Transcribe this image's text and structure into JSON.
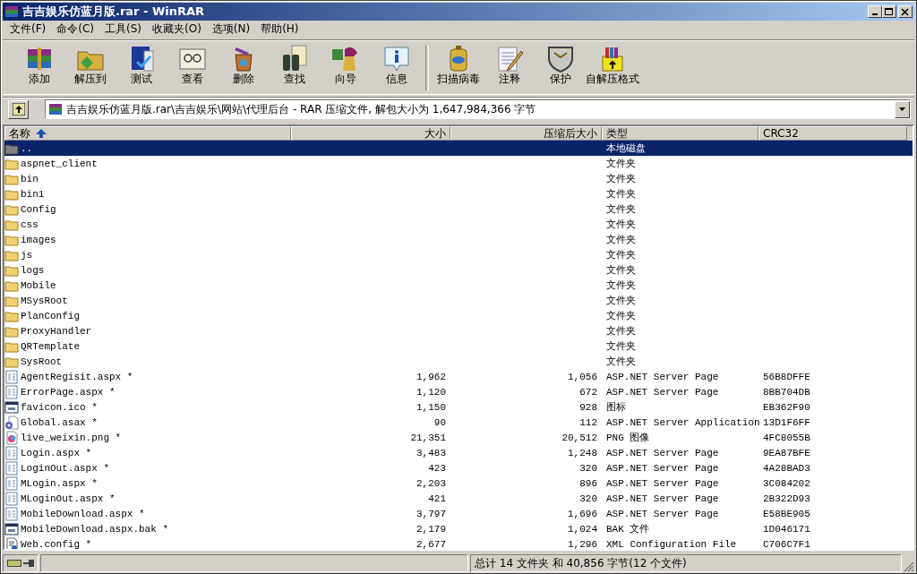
{
  "window": {
    "title": "吉吉娱乐仿蓝月版.rar - WinRAR"
  },
  "menu": [
    "文件(F)",
    "命令(C)",
    "工具(S)",
    "收藏夹(O)",
    "选项(N)",
    "帮助(H)"
  ],
  "toolbar_groups": [
    {
      "buttons": [
        "添加",
        "解压到",
        "测试",
        "查看",
        "删除",
        "查找",
        "向导",
        "信息"
      ]
    },
    {
      "buttons": [
        "扫描病毒",
        "注释",
        "保护",
        "自解压格式"
      ]
    }
  ],
  "address": {
    "value": "吉吉娱乐仿蓝月版.rar\\吉吉娱乐\\网站\\代理后台 - RAR 压缩文件, 解包大小为 1,647,984,366 字节"
  },
  "table": {
    "columns": [
      {
        "label": "名称",
        "sorted": true
      },
      {
        "label": "大小",
        "sorted": false
      },
      {
        "label": "压缩后大小",
        "sorted": false
      },
      {
        "label": "类型",
        "sorted": false
      },
      {
        "label": "CRC32",
        "sorted": false
      }
    ],
    "rows": [
      {
        "kind": "up",
        "name": "..",
        "type": "本地磁盘",
        "selected": true
      },
      {
        "kind": "folder",
        "name": "aspnet_client",
        "type": "文件夹",
        "selected": false
      },
      {
        "kind": "folder",
        "name": "bin",
        "type": "文件夹",
        "selected": false
      },
      {
        "kind": "folder",
        "name": "bin1",
        "type": "文件夹",
        "selected": false
      },
      {
        "kind": "folder",
        "name": "Config",
        "type": "文件夹",
        "selected": false
      },
      {
        "kind": "folder",
        "name": "css",
        "type": "文件夹",
        "selected": false
      },
      {
        "kind": "folder",
        "name": "images",
        "type": "文件夹",
        "selected": false
      },
      {
        "kind": "folder",
        "name": "js",
        "type": "文件夹",
        "selected": false
      },
      {
        "kind": "folder",
        "name": "logs",
        "type": "文件夹",
        "selected": false
      },
      {
        "kind": "folder",
        "name": "Mobile",
        "type": "文件夹",
        "selected": false
      },
      {
        "kind": "folder",
        "name": "MSysRoot",
        "type": "文件夹",
        "selected": false
      },
      {
        "kind": "folder",
        "name": "PlanConfig",
        "type": "文件夹",
        "selected": false
      },
      {
        "kind": "folder",
        "name": "ProxyHandler",
        "type": "文件夹",
        "selected": false
      },
      {
        "kind": "folder",
        "name": "QRTemplate",
        "type": "文件夹",
        "selected": false
      },
      {
        "kind": "folder",
        "name": "SysRoot",
        "type": "文件夹",
        "selected": false
      },
      {
        "kind": "page",
        "name": "AgentRegisit.aspx *",
        "size": "1,962",
        "packed": "1,056",
        "type": "ASP.NET Server Page",
        "crc": "56B8DFFE",
        "selected": false
      },
      {
        "kind": "page",
        "name": "ErrorPage.aspx *",
        "size": "1,120",
        "packed": "672",
        "type": "ASP.NET Server Page",
        "crc": "8BB704DB",
        "selected": false
      },
      {
        "kind": "window",
        "name": "favicon.ico *",
        "size": "1,150",
        "packed": "928",
        "type": "图标",
        "crc": "EB362F90",
        "selected": false
      },
      {
        "kind": "gear",
        "name": "Global.asax *",
        "size": "90",
        "packed": "112",
        "type": "ASP.NET Server Application",
        "crc": "13D1F6FF",
        "selected": false
      },
      {
        "kind": "picture",
        "name": "live_weixin.png *",
        "size": "21,351",
        "packed": "20,512",
        "type": "PNG 图像",
        "crc": "4FC8055B",
        "selected": false
      },
      {
        "kind": "page",
        "name": "Login.aspx *",
        "size": "3,483",
        "packed": "1,248",
        "type": "ASP.NET Server Page",
        "crc": "9EA87BFE",
        "selected": false
      },
      {
        "kind": "page",
        "name": "LoginOut.aspx *",
        "size": "423",
        "packed": "320",
        "type": "ASP.NET Server Page",
        "crc": "4A28BAD3",
        "selected": false
      },
      {
        "kind": "page",
        "name": "MLogin.aspx *",
        "size": "2,203",
        "packed": "896",
        "type": "ASP.NET Server Page",
        "crc": "3C084202",
        "selected": false
      },
      {
        "kind": "page",
        "name": "MLoginOut.aspx *",
        "size": "421",
        "packed": "320",
        "type": "ASP.NET Server Page",
        "crc": "2B322D93",
        "selected": false
      },
      {
        "kind": "page",
        "name": "MobileDownload.aspx *",
        "size": "3,797",
        "packed": "1,696",
        "type": "ASP.NET Server Page",
        "crc": "E58BE905",
        "selected": false
      },
      {
        "kind": "window",
        "name": "MobileDownload.aspx.bak *",
        "size": "2,179",
        "packed": "1,024",
        "type": "BAK 文件",
        "crc": "1D046171",
        "selected": false
      },
      {
        "kind": "config",
        "name": "Web.config *",
        "size": "2,677",
        "packed": "1,296",
        "type": "XML Configuration File",
        "crc": "C706C7F1",
        "selected": false
      }
    ]
  },
  "status_bar": {
    "summary": "总计 14 文件夹 和 40,856 字节(12 个文件)"
  }
}
